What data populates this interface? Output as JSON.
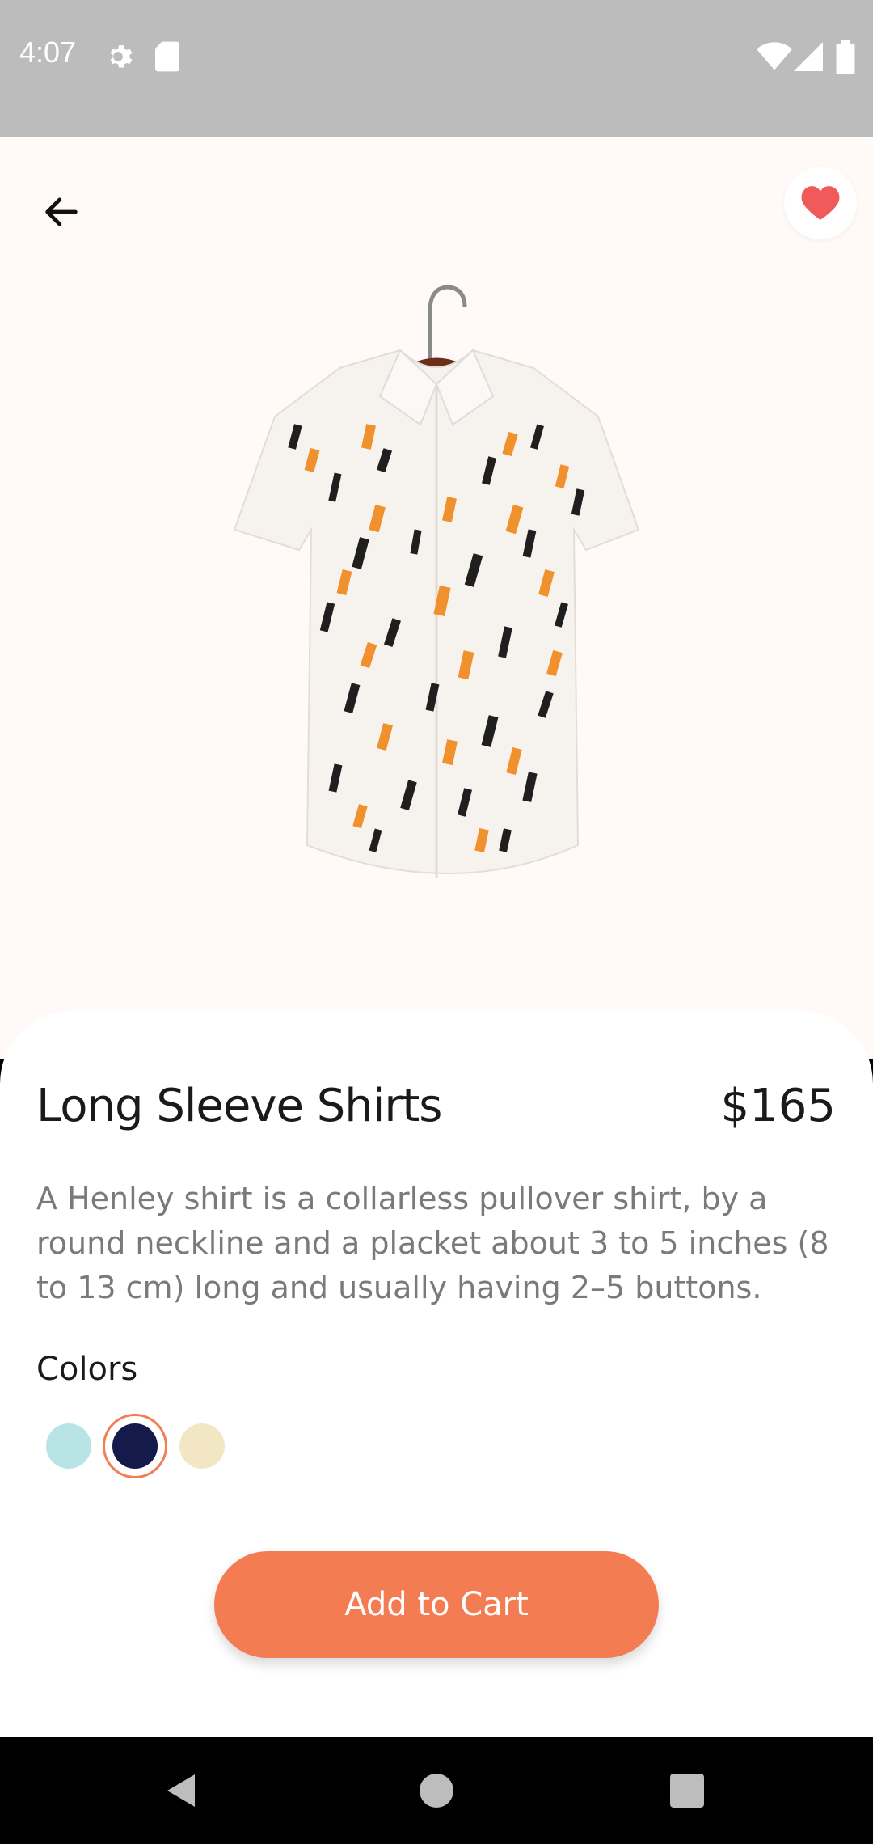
{
  "status_bar": {
    "time": "4:07",
    "icons": [
      "gear-icon",
      "sd-card-icon",
      "wifi-icon",
      "signal-icon",
      "battery-icon"
    ]
  },
  "header": {
    "back_icon": "arrow-left-icon",
    "favorite_icon": "heart-icon",
    "favorite_active": true
  },
  "product": {
    "title": "Long Sleeve Shirts",
    "price": "$165",
    "description": "A Henley shirt is a collarless pullover shirt, by a round neckline and a placket about 3 to 5 inches (8 to 13 cm) long and usually having 2–5 buttons.",
    "colors_label": "Colors",
    "colors": [
      {
        "hex": "#b8e4e6",
        "selected": false
      },
      {
        "hex": "#141a4a",
        "selected": true
      },
      {
        "hex": "#f2e6c4",
        "selected": false
      }
    ],
    "add_to_cart_label": "Add to Cart"
  },
  "theme": {
    "accent": "#f47c52",
    "heart": "#f05a5a",
    "hero_bg": "#fffaf7"
  },
  "nav": {
    "icons": [
      "back-triangle-icon",
      "home-circle-icon",
      "recents-square-icon"
    ]
  }
}
